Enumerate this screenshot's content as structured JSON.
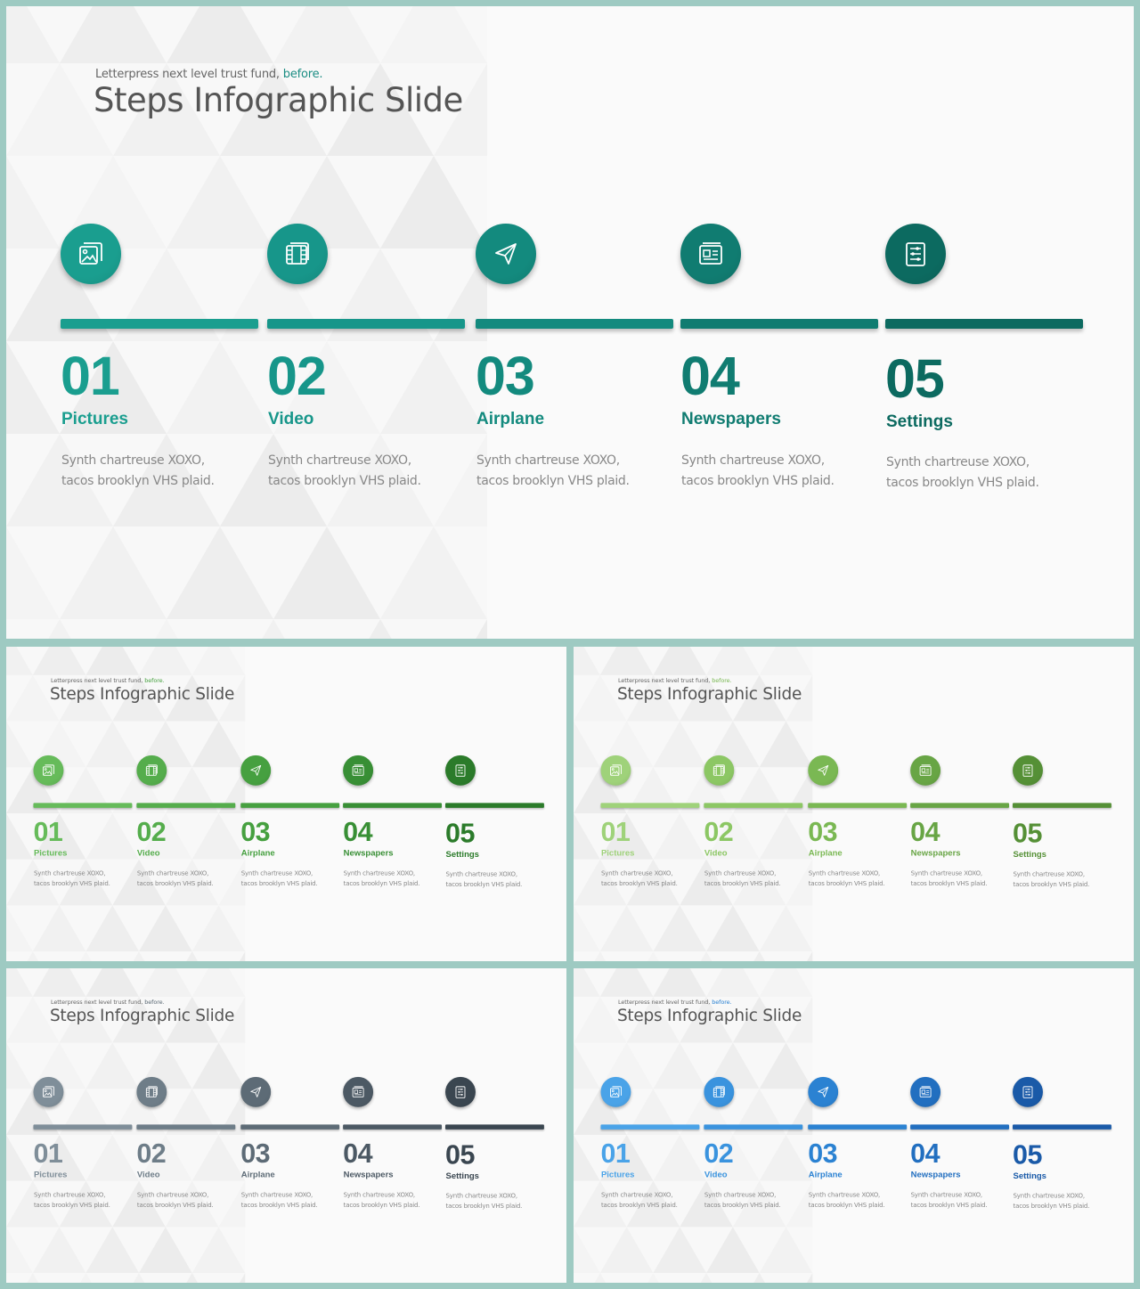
{
  "subtitle_text": "Letterpress next level trust fund, ",
  "subtitle_accent": "before.",
  "title": "Steps Infographic Slide",
  "description": "Synth chartreuse XOXO, tacos brooklyn VHS plaid.",
  "steps": [
    {
      "number": "01",
      "label": "Pictures",
      "icon": "pictures-icon"
    },
    {
      "number": "02",
      "label": "Video",
      "icon": "video-icon"
    },
    {
      "number": "03",
      "label": "Airplane",
      "icon": "airplane-icon"
    },
    {
      "number": "04",
      "label": "Newspapers",
      "icon": "newspaper-icon"
    },
    {
      "number": "05",
      "label": "Settings",
      "icon": "settings-icon"
    }
  ],
  "themes": [
    {
      "name": "teal",
      "colors": [
        "#1a9e8f",
        "#17968a",
        "#138a7e",
        "#107c71",
        "#0c6a60"
      ],
      "accent": "#1b8d83"
    },
    {
      "name": "green",
      "colors": [
        "#66bb5a",
        "#55ad4c",
        "#46a040",
        "#388f35",
        "#2b7b2a"
      ],
      "accent": "#4aa343"
    },
    {
      "name": "light-green",
      "colors": [
        "#9fd27a",
        "#8cc764",
        "#7ab853",
        "#68a545",
        "#559036"
      ],
      "accent": "#7ab853"
    },
    {
      "name": "slate",
      "colors": [
        "#7f8e99",
        "#6e7d88",
        "#5d6b76",
        "#4c5964",
        "#3a4650"
      ],
      "accent": "#5d6b76"
    },
    {
      "name": "blue",
      "colors": [
        "#4aa3e8",
        "#3a93de",
        "#2b82d2",
        "#226fc0",
        "#1a5aa8"
      ],
      "accent": "#2b82d2"
    }
  ]
}
